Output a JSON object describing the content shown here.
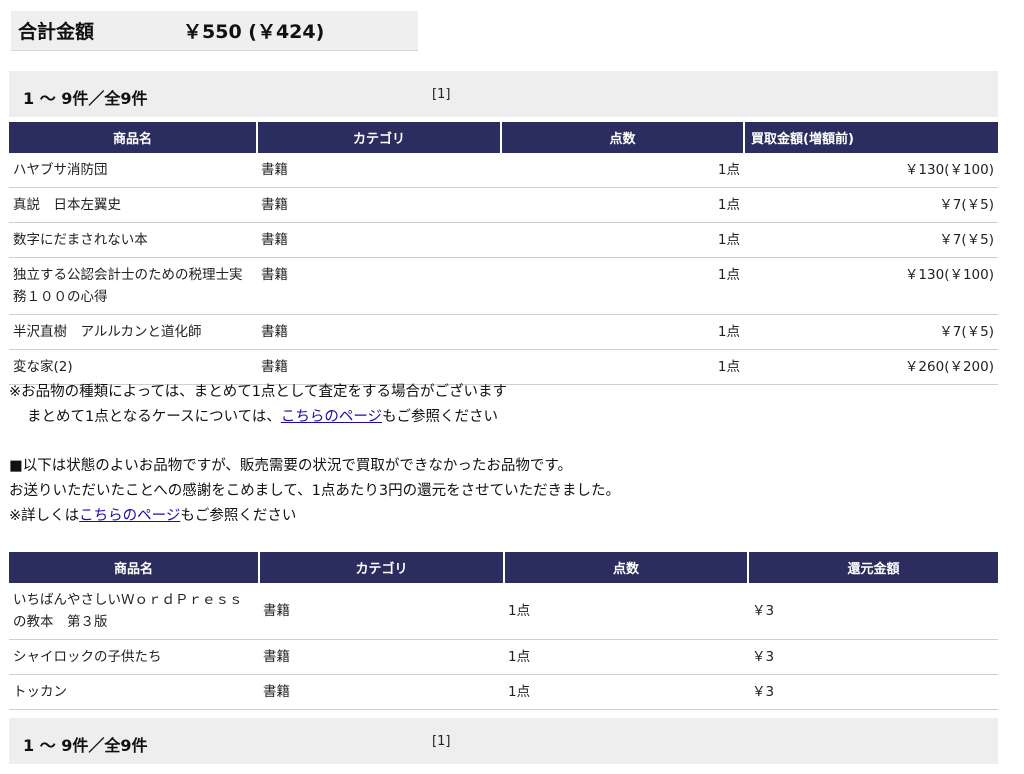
{
  "summary": {
    "label": "合計金額",
    "value": "￥550 (￥424)"
  },
  "pager": {
    "count_text": "1 〜 9件／全9件",
    "page_link": "[1]"
  },
  "purchased_table": {
    "headers": [
      "商品名",
      "カテゴリ",
      "点数",
      "買取金額(増額前)"
    ],
    "rows": [
      {
        "name": "ハヤブサ消防団",
        "category": "書籍",
        "qty": "1点",
        "price": "￥130(￥100)"
      },
      {
        "name": "真説　日本左翼史",
        "category": "書籍",
        "qty": "1点",
        "price": "￥7(￥5)"
      },
      {
        "name": "数字にだまされない本",
        "category": "書籍",
        "qty": "1点",
        "price": "￥7(￥5)"
      },
      {
        "name": "独立する公認会計士のための税理士実務１００の心得",
        "category": "書籍",
        "qty": "1点",
        "price": "￥130(￥100)"
      },
      {
        "name": "半沢直樹　アルルカンと道化師",
        "category": "書籍",
        "qty": "1点",
        "price": "￥7(￥5)"
      },
      {
        "name": "変な家(2)",
        "category": "書籍",
        "qty": "1点",
        "price": "￥260(￥200)"
      }
    ]
  },
  "note1": {
    "line1": "※お品物の種類によっては、まとめて1点として査定をする場合がございます",
    "line2_prefix": "まとめて1点となるケースについては、",
    "line2_link": "こちらのページ",
    "line2_suffix": "もご参照ください"
  },
  "note2": {
    "line1": "■以下は状態のよいお品物ですが、販売需要の状況で買取ができなかったお品物です。",
    "line2": "お送りいただいたことへの感謝をこめまして、1点あたり3円の還元をさせていただきました。",
    "line3_prefix": "※詳しくは",
    "line3_link": "こちらのページ",
    "line3_suffix": "もご参照ください"
  },
  "returned_table": {
    "headers": [
      "商品名",
      "カテゴリ",
      "点数",
      "還元金額"
    ],
    "rows": [
      {
        "name": "いちばんやさしいＷｏｒｄＰｒｅｓｓの教本　第３版",
        "category": "書籍",
        "qty": "1点",
        "amount": "￥3"
      },
      {
        "name": "シャイロックの子供たち",
        "category": "書籍",
        "qty": "1点",
        "amount": "￥3"
      },
      {
        "name": "トッカン",
        "category": "書籍",
        "qty": "1点",
        "amount": "￥3"
      }
    ]
  }
}
